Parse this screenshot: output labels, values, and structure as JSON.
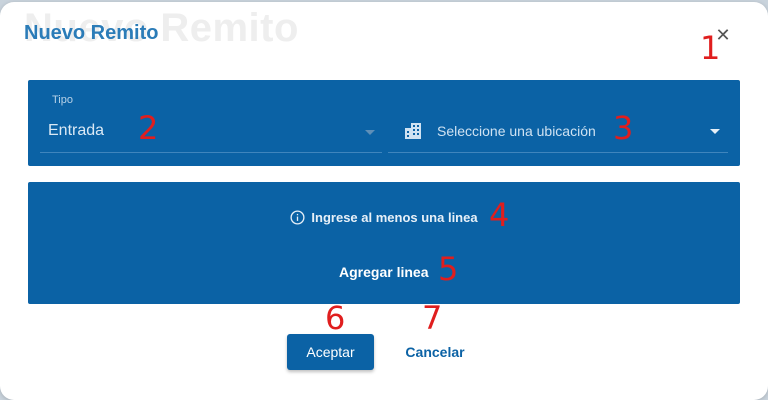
{
  "dialog": {
    "title": "Nuevo Remito",
    "ghost_title": "Nuevo Remito",
    "close_symbol": "✕"
  },
  "form": {
    "tipo": {
      "label": "Tipo",
      "value": "Entrada"
    },
    "ubicacion": {
      "placeholder": "Seleccione una ubicación",
      "icon": "building-icon"
    }
  },
  "lines": {
    "info_text": "Ingrese al menos una linea",
    "info_icon": "info-icon",
    "add_label": "Agregar linea"
  },
  "actions": {
    "accept_label": "Aceptar",
    "cancel_label": "Cancelar"
  },
  "annotations": [
    "1",
    "2",
    "3",
    "4",
    "5",
    "6",
    "7"
  ],
  "colors": {
    "accent": "#0b62a5",
    "title": "#2b7cb8",
    "annotation": "#e01e1e"
  }
}
